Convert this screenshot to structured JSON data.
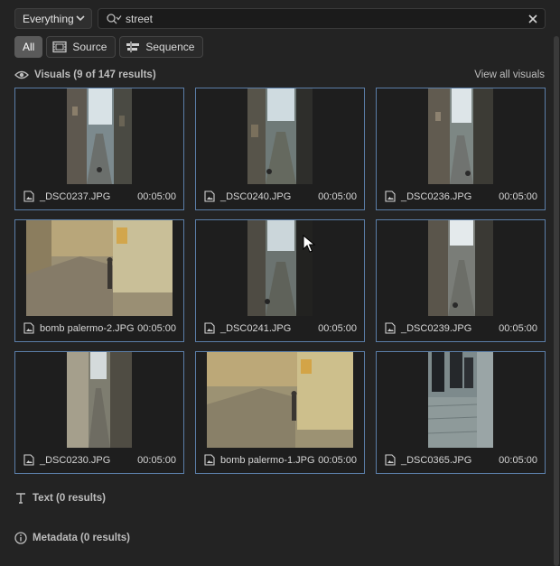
{
  "scope": {
    "value": "Everything"
  },
  "search": {
    "query": "street"
  },
  "filters": [
    {
      "label": "All",
      "active": true
    },
    {
      "label": "Source",
      "icon": "source-icon"
    },
    {
      "label": "Sequence",
      "icon": "sequence-icon"
    }
  ],
  "visuals": {
    "title": "Visuals (9 of 147 results)",
    "view_all": "View all visuals",
    "items": [
      {
        "name": "_DSC0237.JPG",
        "duration": "00:05:00"
      },
      {
        "name": "_DSC0240.JPG",
        "duration": "00:05:00"
      },
      {
        "name": "_DSC0236.JPG",
        "duration": "00:05:00"
      },
      {
        "name": "bomb palermo-2.JPG",
        "duration": "00:05:00"
      },
      {
        "name": "_DSC0241.JPG",
        "duration": "00:05:00"
      },
      {
        "name": "_DSC0239.JPG",
        "duration": "00:05:00"
      },
      {
        "name": "_DSC0230.JPG",
        "duration": "00:05:00"
      },
      {
        "name": "bomb palermo-1.JPG",
        "duration": "00:05:00"
      },
      {
        "name": "_DSC0365.JPG",
        "duration": "00:05:00"
      }
    ]
  },
  "text_section": {
    "title": "Text (0 results)"
  },
  "metadata_section": {
    "title": "Metadata (0 results)"
  },
  "colors": {
    "background": "#232323",
    "card_border": "#5b7ea8"
  }
}
